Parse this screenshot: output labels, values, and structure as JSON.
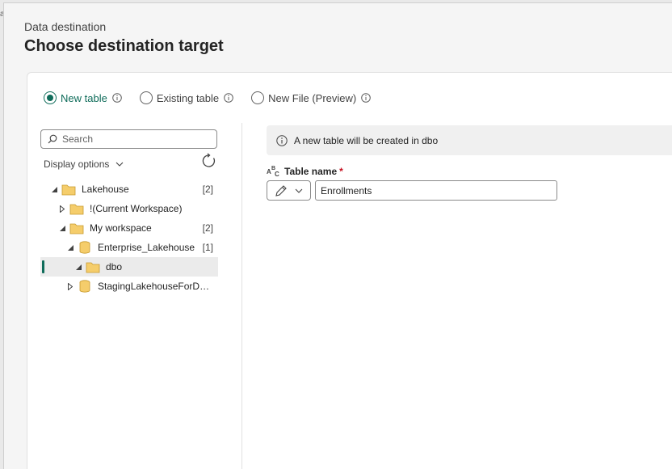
{
  "header": {
    "subtitle": "Data destination",
    "title": "Choose destination target"
  },
  "radio_options": [
    {
      "label": "New table",
      "checked": true
    },
    {
      "label": "Existing table",
      "checked": false
    },
    {
      "label": "New File (Preview)",
      "checked": false
    }
  ],
  "search": {
    "placeholder": "Search"
  },
  "display_options": {
    "label": "Display options"
  },
  "tree": [
    {
      "label": "Lakehouse",
      "count": "[2]",
      "type": "folder",
      "expanded": true
    },
    {
      "label": "!(Current Workspace)",
      "count": "",
      "type": "folder",
      "expanded": false
    },
    {
      "label": "My workspace",
      "count": "[2]",
      "type": "folder",
      "expanded": true
    },
    {
      "label": "Enterprise_Lakehouse",
      "count": "[1]",
      "type": "database",
      "expanded": true
    },
    {
      "label": "dbo",
      "count": "",
      "type": "folder",
      "expanded": true,
      "selected": true
    },
    {
      "label": "StagingLakehouseForDat...",
      "count": "",
      "type": "database",
      "expanded": false
    }
  ],
  "banner": {
    "text": "A new table will be created in dbo"
  },
  "field": {
    "label": "Table name",
    "required_mark": "*",
    "value": "Enrollments"
  },
  "colors": {
    "accent": "#0f6c5a",
    "required": "#c50f1f",
    "folder": "#f5cd6b"
  }
}
